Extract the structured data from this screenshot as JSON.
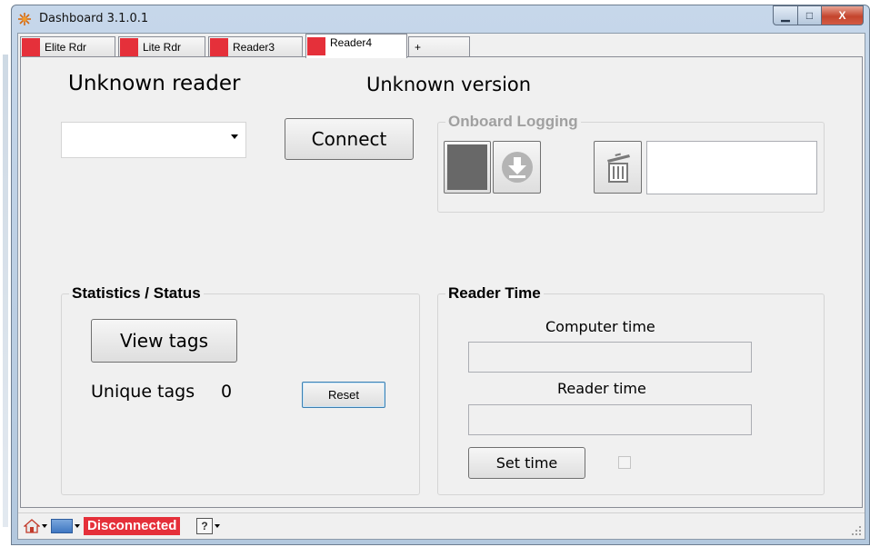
{
  "window": {
    "title": "Dashboard 3.1.0.1",
    "controls": {
      "minimize": "▁",
      "maximize": "□",
      "close": "X"
    }
  },
  "tabs": [
    {
      "label": "Elite Rdr",
      "active": false,
      "indicator_color": "#e5303a"
    },
    {
      "label": "Lite Rdr",
      "active": false,
      "indicator_color": "#e5303a"
    },
    {
      "label": "Reader3",
      "active": false,
      "indicator_color": "#e5303a"
    },
    {
      "label": "Reader4",
      "active": true,
      "indicator_color": "#e5303a"
    },
    {
      "label": "+",
      "active": false
    }
  ],
  "header": {
    "reader_name": "Unknown reader",
    "reader_version": "Unknown version"
  },
  "connection": {
    "port_value": "",
    "connect_label": "Connect"
  },
  "onboard_logging": {
    "title": "Onboard Logging",
    "enabled": false,
    "log_value": "",
    "icons": [
      "stop-square-icon",
      "download-icon",
      "trash-icon"
    ]
  },
  "statistics": {
    "title": "Statistics / Status",
    "view_tags_label": "View tags",
    "unique_tags_label": "Unique tags",
    "unique_tags_count": "0",
    "reset_label": "Reset"
  },
  "reader_time": {
    "title": "Reader Time",
    "computer_time_label": "Computer time",
    "computer_time_value": "",
    "reader_time_label": "Reader time",
    "reader_time_value": "",
    "set_time_label": "Set time",
    "auto_sync_checked": false
  },
  "statusbar": {
    "status_text": "Disconnected",
    "status_color": "#e5303a",
    "help_label": "?"
  },
  "colors": {
    "accent_red": "#e5303a",
    "window_frame": "#b9cde3"
  }
}
